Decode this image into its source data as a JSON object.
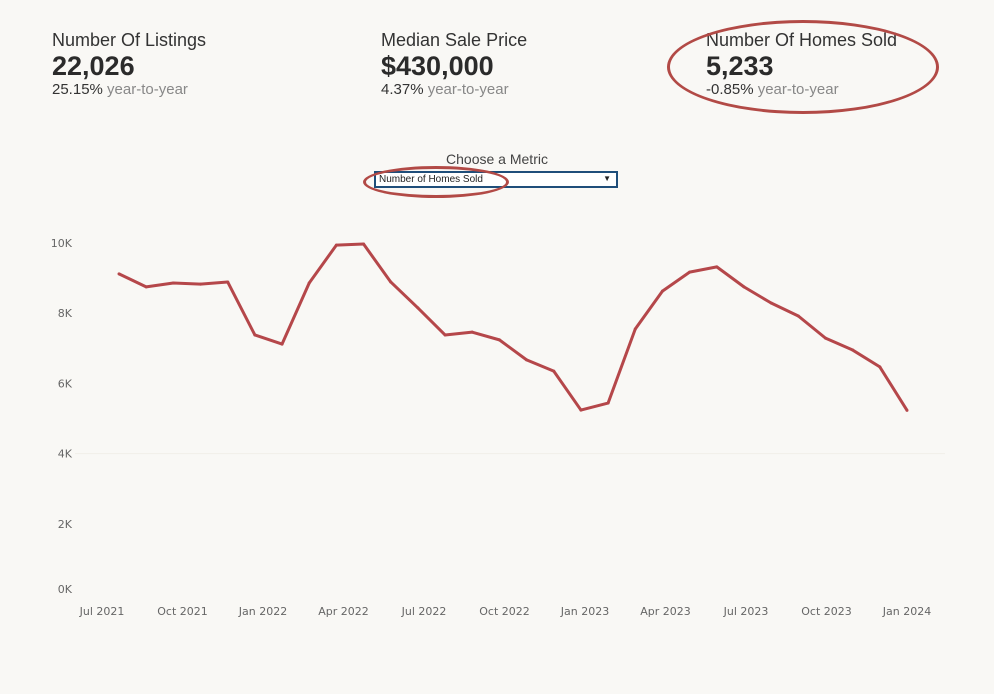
{
  "kpis": [
    {
      "title": "Number Of Listings",
      "value": "22,026",
      "change": "25.15%",
      "change_label": "year-to-year"
    },
    {
      "title": "Median Sale Price",
      "value": "$430,000",
      "change": "4.37%",
      "change_label": "year-to-year"
    },
    {
      "title": "Number Of Homes Sold",
      "value": "5,233",
      "change": "-0.85%",
      "change_label": "year-to-year"
    }
  ],
  "filter": {
    "label": "Choose a Metric",
    "selected": "Number of Homes Sold"
  },
  "chart_data": {
    "type": "line",
    "title": "",
    "xlabel": "",
    "ylabel": "",
    "ylim": [
      0,
      10000
    ],
    "yticks": [
      {
        "v": 0,
        "label": "0K"
      },
      {
        "v": 2000,
        "label": "2K"
      },
      {
        "v": 4000,
        "label": "4K"
      },
      {
        "v": 6000,
        "label": "6K"
      },
      {
        "v": 8000,
        "label": "8K"
      },
      {
        "v": 10000,
        "label": "10K"
      }
    ],
    "xticks": [
      "Jul 2021",
      "Oct 2021",
      "Jan 2022",
      "Apr 2022",
      "Jul 2022",
      "Oct 2022",
      "Jan 2023",
      "Apr 2023",
      "Jul 2023",
      "Oct 2023",
      "Jan 2024"
    ],
    "x": [
      "2021-07",
      "2021-08",
      "2021-09",
      "2021-10",
      "2021-11",
      "2021-12",
      "2022-01",
      "2022-02",
      "2022-03",
      "2022-04",
      "2022-05",
      "2022-06",
      "2022-07",
      "2022-08",
      "2022-09",
      "2022-10",
      "2022-11",
      "2022-12",
      "2023-01",
      "2023-02",
      "2023-03",
      "2023-04",
      "2023-05",
      "2023-06",
      "2023-07",
      "2023-08",
      "2023-09",
      "2023-10",
      "2023-11",
      "2023-12"
    ],
    "values": [
      9120,
      8750,
      8860,
      8830,
      8890,
      7380,
      7120,
      8860,
      9940,
      9970,
      8890,
      8150,
      7380,
      7460,
      7240,
      6670,
      6350,
      5240,
      5440,
      7550,
      8630,
      9170,
      9320,
      8750,
      8290,
      7920,
      7290,
      6950,
      6470,
      5233
    ],
    "color": "#b5474a",
    "grid": false
  },
  "highlight_color": "#b24a46"
}
